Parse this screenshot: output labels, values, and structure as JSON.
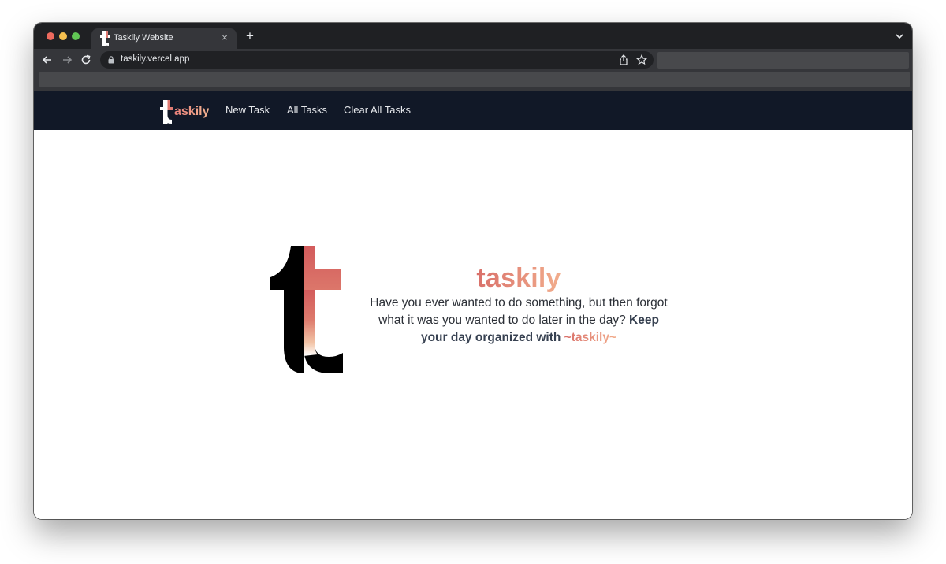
{
  "browser": {
    "tab": {
      "title": "Taskily Website",
      "close_glyph": "×"
    },
    "new_tab_glyph": "+",
    "address_bar": {
      "url": "taskily.vercel.app"
    },
    "icons": {
      "back": "arrow-left-icon",
      "forward": "arrow-right-icon",
      "reload": "reload-icon",
      "lock": "lock-icon",
      "share": "share-icon",
      "bookmark": "star-icon",
      "tab_menu": "chevron-down-icon"
    },
    "colors": {
      "frame": "#1f2023",
      "toolbar": "#35363a",
      "omnibox": "#202124"
    }
  },
  "site": {
    "nav": {
      "brand_letter": "t",
      "brand_text": "askily",
      "links": [
        {
          "label": "New Task"
        },
        {
          "label": "All Tasks"
        },
        {
          "label": "Clear All Tasks"
        }
      ]
    },
    "hero": {
      "title": "taskily",
      "body_prefix": "Have you ever wanted to do something, but then forgot what it was you wanted to do later in the day? ",
      "body_strong": "Keep your day organized with ",
      "body_accent": "~taskily~"
    },
    "colors": {
      "nav_background": "#111827",
      "accent_start": "#d9706a",
      "accent_end": "#f2ad8c",
      "text": "#374151"
    }
  }
}
